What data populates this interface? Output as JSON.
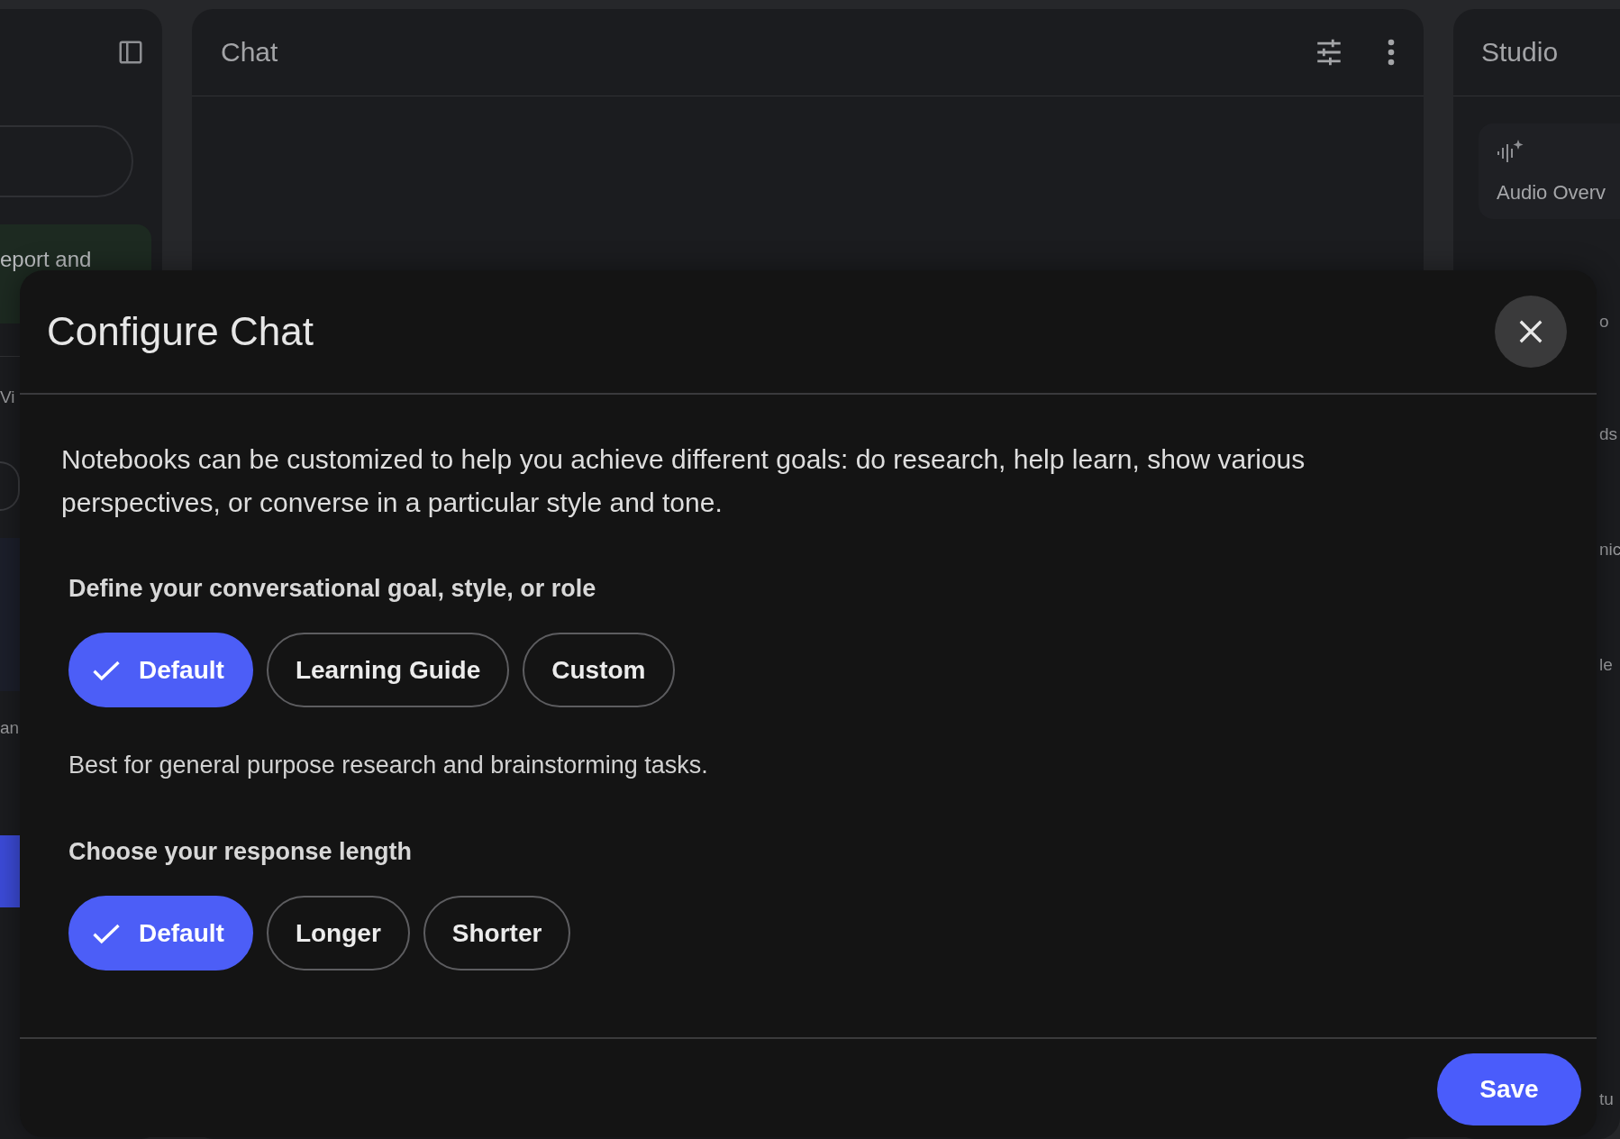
{
  "sidebar": {
    "card_text": "eport and",
    "item_text": "Vi",
    "row_text": "an"
  },
  "chat": {
    "title": "Chat"
  },
  "studio": {
    "title": "Studio",
    "tile_label": "Audio Overv",
    "fragments": [
      "o",
      "ds",
      "nic",
      "le",
      "tu"
    ]
  },
  "dialog": {
    "title": "Configure Chat",
    "intro": "Notebooks can be customized to help you achieve different goals: do research, help learn, show various perspectives, or converse in a particular style and tone.",
    "sections": [
      {
        "label": "Define your conversational goal, style, or role",
        "options": [
          {
            "label": "Default",
            "selected": true
          },
          {
            "label": "Learning Guide",
            "selected": false
          },
          {
            "label": "Custom",
            "selected": false
          }
        ],
        "description": "Best for general purpose research and brainstorming tasks."
      },
      {
        "label": "Choose your response length",
        "options": [
          {
            "label": "Default",
            "selected": true
          },
          {
            "label": "Longer",
            "selected": false
          },
          {
            "label": "Shorter",
            "selected": false
          }
        ]
      }
    ],
    "save": "Save"
  }
}
